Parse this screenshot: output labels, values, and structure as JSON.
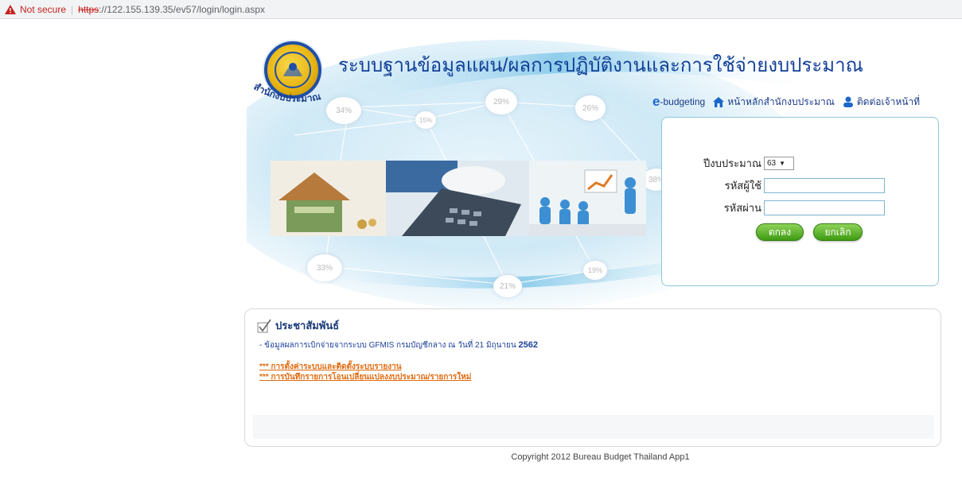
{
  "browser": {
    "not_secure": "Not secure",
    "protocol": "https",
    "url_rest": "://122.155.139.35/ev57/login/login.aspx"
  },
  "banner": {
    "title": "ระบบฐานข้อมูลแผน/ผลการปฏิบัติงานและการใช้จ่ายงบประมาณ",
    "logo_arc_text": "สำนักงบประมาณ",
    "percents": [
      "34%",
      "15%",
      "29%",
      "26%",
      "38%",
      "33%",
      "21%",
      "19%"
    ]
  },
  "toplinks": {
    "ebudget_e": "e",
    "ebudget": "-budgeting",
    "home": "หน้าหลักสำนักงบประมาณ",
    "contact": "ติดต่อเจ้าหน้าที่"
  },
  "login": {
    "year_label": "ปีงบประมาณ",
    "year_value": "63",
    "user_label": "รหัสผู้ใช้",
    "pass_label": "รหัสผ่าน",
    "ok_label": "ตกลง",
    "cancel_label": "ยกเลิก"
  },
  "news": {
    "title": "ประชาสัมพันธ์",
    "line_text": "- ข้อมูลผลการเบิกจ่ายจากระบบ GFMIS กรมบัญชีกลาง ณ วันที่ 21 มิถุนายน",
    "line_year": "2562",
    "link1": "*** การตั้งค่าระบบและติดตั้งระบบรายงาน",
    "link2": "*** การบันทึกรายการโอนเปลี่ยนแปลงงบประมาณ/รายการใหม่"
  },
  "footer": {
    "copyright": "Copyright 2012 Bureau Budget Thailand App1"
  },
  "colors": {
    "title_blue": "#123f98",
    "button_green": "#3e9b11",
    "link_orange": "#e06a0f",
    "not_secure_red": "#c5221f"
  }
}
